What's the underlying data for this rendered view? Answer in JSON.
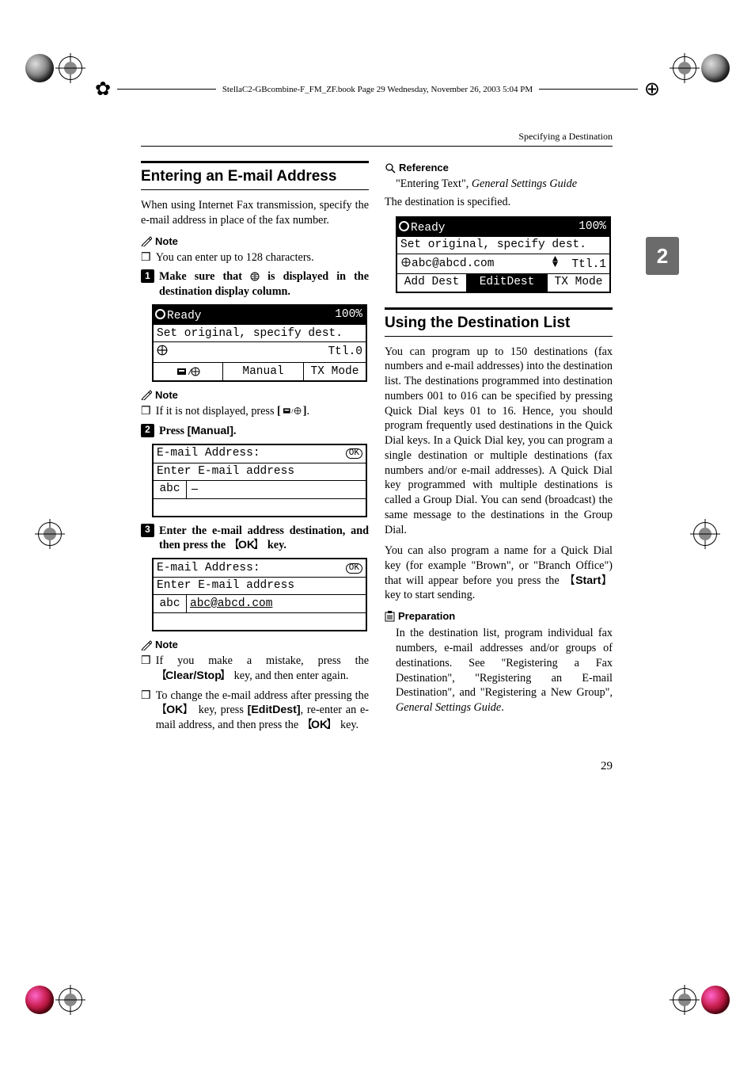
{
  "header": {
    "filepath": "StellaC2-GBcombine-F_FM_ZF.book  Page 29  Wednesday, November 26, 2003  5:04 PM"
  },
  "running_head": "Specifying a Destination",
  "side_tab": "2",
  "page_number": "29",
  "left": {
    "h2": "Entering an E-mail Address",
    "intro": "When using Internet Fax transmission, specify the e-mail address in place of the fax number.",
    "note1_label": "Note",
    "note1_item": "You can enter up to 128 characters.",
    "step1": "Make sure that  is displayed in the destination display column.",
    "step1_pre": "Make sure that ",
    "step1_post": " is displayed in the destination display column.",
    "lcd1": {
      "ready": "Ready",
      "percent": "100%",
      "line2": "Set original, specify dest.",
      "ttl": "Ttl.0",
      "manual": "Manual",
      "txmode": "TX Mode"
    },
    "note2_label": "Note",
    "note2_pre": "If it is not displayed, press ",
    "step2_pre": "Press ",
    "step2_key": "[Manual]",
    "step2_post": ".",
    "lcd2": {
      "title": "E-mail Address:",
      "ok": "OK",
      "prompt": "Enter E-mail address",
      "val": "abc"
    },
    "step3_pre": "Enter the e-mail address destination, and then press the ",
    "step3_key": "OK",
    "step3_post": " key.",
    "lcd3": {
      "title": "E-mail Address:",
      "ok": "OK",
      "prompt": "Enter E-mail address",
      "val_pre": "abc",
      "val_mail": "abc@abcd.com"
    },
    "note3_label": "Note",
    "note3_a_pre": "If you make a mistake, press the ",
    "note3_a_key": "Clear/Stop",
    "note3_a_post": " key, and then enter again.",
    "note3_b_pre": "To change the e-mail address after pressing the ",
    "note3_b_key1": "OK",
    "note3_b_mid": " key, press ",
    "note3_b_soft": "[EditDest]",
    "note3_b_mid2": ", re-enter an e-mail address, and then press the ",
    "note3_b_key2": "OK",
    "note3_b_post": " key."
  },
  "right": {
    "ref_label": "Reference",
    "ref_text_a": "\"Entering Text\", ",
    "ref_text_b": "General Settings Guide",
    "dest_specified": "The destination is specified.",
    "lcd4": {
      "ready": "Ready",
      "percent": "100%",
      "line2": "Set original, specify dest.",
      "email": "abc@abcd.com",
      "ttl": "Ttl.1",
      "adddest": "Add Dest",
      "editdest": "EditDest",
      "txmode": "TX Mode"
    },
    "h2": "Using the Destination List",
    "para1": "You can program up to 150 destinations (fax numbers and e-mail addresses) into the destination list. The destinations programmed into destination numbers 001 to 016 can be specified by pressing Quick Dial keys 01 to 16. Hence, you should program frequently used destinations in the Quick Dial keys. In a Quick Dial key, you can program a single destination or multiple destinations (fax numbers and/or e-mail addresses). A Quick Dial key programmed with multiple destinations is called a Group Dial. You can send (broadcast) the same message to the destinations in the Group Dial.",
    "para2_pre": "You can also program a name for a Quick Dial key (for example \"Brown\", or \"Branch Office\") that will appear before you press the ",
    "para2_key": "Start",
    "para2_post": " key to start sending.",
    "prep_label": "Preparation",
    "prep_text_a": "In the destination list, program individual fax numbers, e-mail addresses and/or groups of destinations. See \"Registering a Fax Destination\", \"Registering an E-mail Destination\", and \"Registering a New Group\", ",
    "prep_text_b": "General Settings Guide",
    "prep_text_c": "."
  }
}
